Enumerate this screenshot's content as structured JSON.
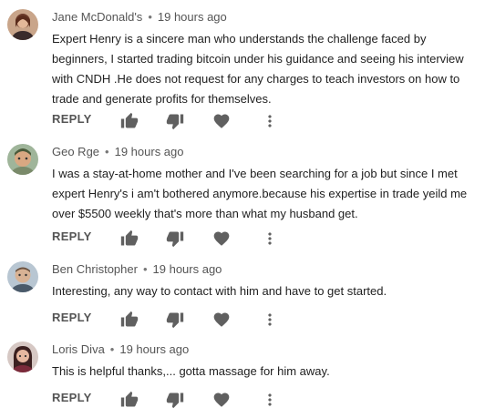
{
  "comments": [
    {
      "author": "Jane McDonald's",
      "separator": "•",
      "time": "19 hours ago",
      "text": "Expert Henry is a sincere man who understands the challenge faced by beginners, I started trading bitcoin under his guidance and seeing his interview with CNDH .He does not request for any charges to teach investors on how to trade and generate profits for themselves.",
      "reply_label": "REPLY"
    },
    {
      "author": "Geo Rge",
      "separator": "•",
      "time": "19 hours ago",
      "text": "I was a stay-at-home mother and I've been searching for a  job but since I met expert Henry's  i am't bothered anymore.because his expertise in trade yeild me over $5500 weekly that's more than what my husband get.",
      "reply_label": "REPLY"
    },
    {
      "author": "Ben Christopher",
      "separator": "•",
      "time": "19 hours ago",
      "text": "Interesting, any way to contact  with him and have to get started.",
      "reply_label": "REPLY"
    },
    {
      "author": "Loris Diva",
      "separator": "•",
      "time": "19 hours ago",
      "text": "This is helpful thanks,... gotta massage for him away.",
      "reply_label": "REPLY"
    }
  ],
  "icons": {
    "like": "thumbs-up-icon",
    "dislike": "thumbs-down-icon",
    "heart": "heart-icon",
    "more": "more-vert-icon"
  },
  "colors": {
    "text": "#212121",
    "meta": "#555555",
    "icon": "#606060"
  }
}
